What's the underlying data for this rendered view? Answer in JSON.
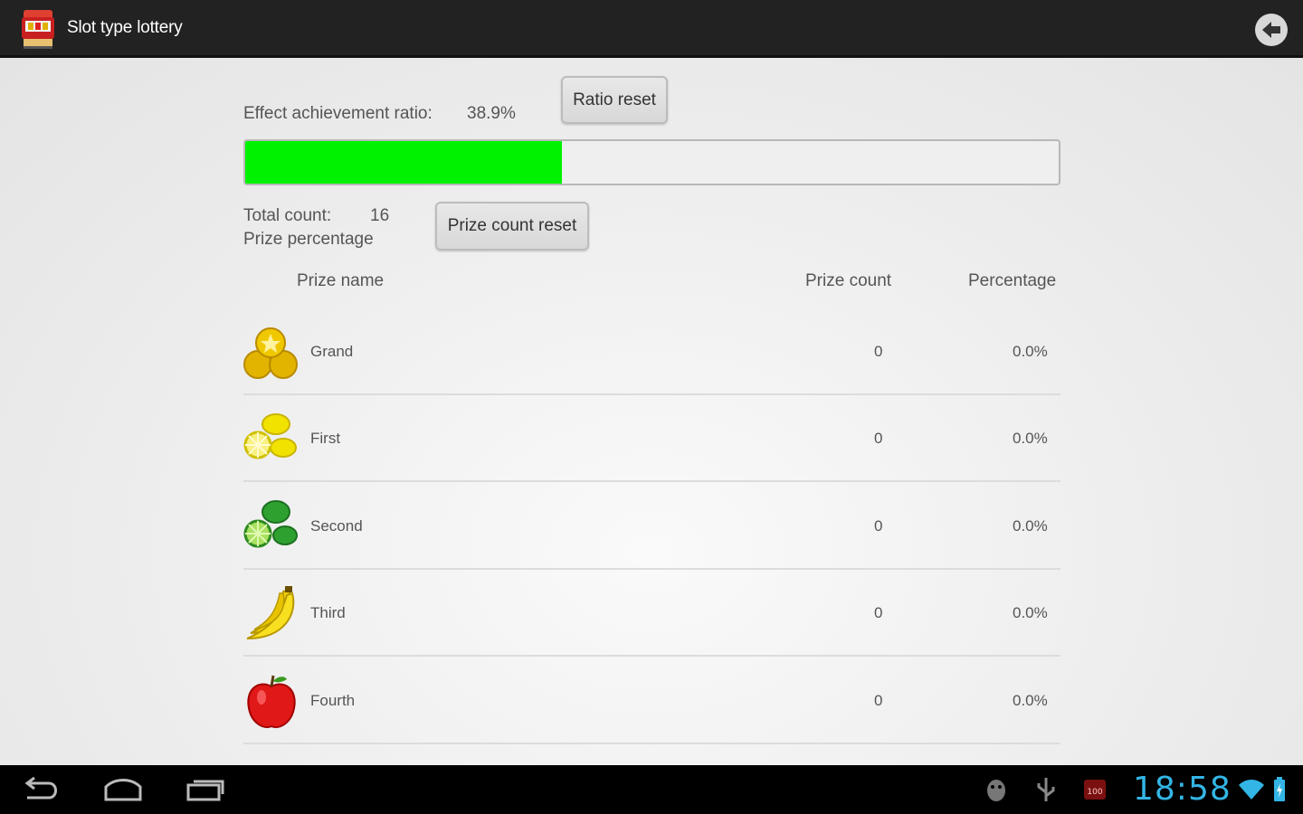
{
  "app": {
    "title": "Slot type lottery"
  },
  "stats": {
    "ratio_label": "Effect achievement ratio:",
    "ratio_value": "38.9%",
    "ratio_fraction": 0.389,
    "ratio_reset_label": "Ratio reset",
    "total_count_label": "Total count:",
    "total_count_value": "16",
    "prize_percentage_label": "Prize percentage",
    "prize_count_reset_label": "Prize count reset"
  },
  "table": {
    "headers": {
      "name": "Prize name",
      "count": "Prize count",
      "percentage": "Percentage"
    },
    "rows": [
      {
        "name": "Grand",
        "count": "0",
        "percentage": "0.0%",
        "icon": "gold-coins-icon"
      },
      {
        "name": "First",
        "count": "0",
        "percentage": "0.0%",
        "icon": "lemon-icon"
      },
      {
        "name": "Second",
        "count": "0",
        "percentage": "0.0%",
        "icon": "lime-icon"
      },
      {
        "name": "Third",
        "count": "0",
        "percentage": "0.0%",
        "icon": "banana-icon"
      },
      {
        "name": "Fourth",
        "count": "0",
        "percentage": "0.0%",
        "icon": "apple-icon"
      }
    ]
  },
  "system": {
    "clock": "18:58",
    "battery_badge": "100"
  },
  "colors": {
    "progress": "#00f200",
    "clock": "#33b5e5",
    "actionbar": "#222222"
  }
}
